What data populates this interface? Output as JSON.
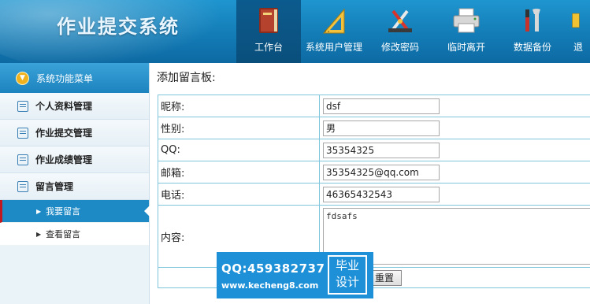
{
  "header": {
    "title": "作业提交系统",
    "nav": [
      {
        "label": "工作台",
        "icon": "book-icon",
        "active": true
      },
      {
        "label": "系统用户管理",
        "icon": "ruler-icon"
      },
      {
        "label": "修改密码",
        "icon": "tools-icon"
      },
      {
        "label": "临时离开",
        "icon": "printer-icon"
      },
      {
        "label": "数据备份",
        "icon": "wrench-icon"
      },
      {
        "label": "退",
        "icon": "exit-icon"
      }
    ]
  },
  "sidebar": {
    "head": "系统功能菜单",
    "items": [
      {
        "label": "个人资料管理"
      },
      {
        "label": "作业提交管理"
      },
      {
        "label": "作业成绩管理"
      },
      {
        "label": "留言管理"
      }
    ],
    "sub_items": [
      {
        "label": "我要留言",
        "active": true
      },
      {
        "label": "查看留言"
      }
    ]
  },
  "main": {
    "title": "添加留言板:",
    "fields": [
      {
        "label": "昵称:",
        "value": "dsf"
      },
      {
        "label": "性别:",
        "value": "男"
      },
      {
        "label": "QQ:",
        "value": "35354325"
      },
      {
        "label": "邮箱:",
        "value": "35354325@qq.com"
      },
      {
        "label": "电话:",
        "value": "46365432543"
      }
    ],
    "content_label": "内容:",
    "content_value": "fdsafs",
    "reset_button": "重置"
  },
  "watermark": {
    "qq": "QQ:459382737",
    "url": "www.kecheng8.com",
    "badge_line1": "毕业",
    "badge_line2": "设计"
  }
}
